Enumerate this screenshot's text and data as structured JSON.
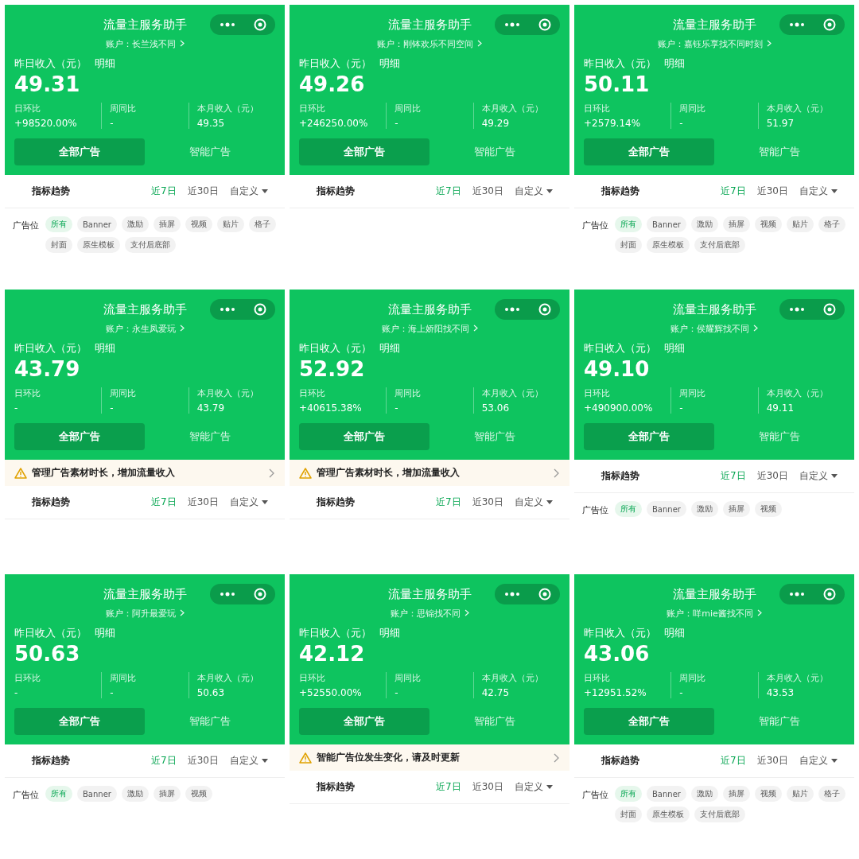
{
  "panels": [
    {
      "title": "流量主服务助手",
      "account": "账户：长兰浅不同",
      "income_label": "昨日收入（元）",
      "detail_link": "明细",
      "income": "49.31",
      "stats": [
        {
          "label": "日环比",
          "value": "+98520.00%"
        },
        {
          "label": "周同比",
          "value": "-"
        },
        {
          "label": "本月收入（元）",
          "value": "49.35"
        }
      ],
      "tabs": [
        {
          "label": "全部广告",
          "selected": true
        },
        {
          "label": "智能广告",
          "selected": false
        }
      ],
      "trend_title": "指标趋势",
      "ranges": [
        {
          "label": "近7日",
          "selected": true
        },
        {
          "label": "近30日",
          "selected": false
        },
        {
          "label": "自定义",
          "selected": false
        }
      ],
      "slot_label": "广告位",
      "slots": [
        {
          "label": "所有",
          "selected": true
        },
        {
          "label": "Banner",
          "selected": false
        },
        {
          "label": "激励",
          "selected": false
        },
        {
          "label": "插屏",
          "selected": false
        },
        {
          "label": "视频",
          "selected": false
        },
        {
          "label": "贴片",
          "selected": false
        },
        {
          "label": "格子",
          "selected": false
        },
        {
          "label": "封面",
          "selected": false
        },
        {
          "label": "原生模板",
          "selected": false
        },
        {
          "label": "支付后底部",
          "selected": false
        }
      ]
    },
    {
      "title": "流量主服务助手",
      "account": "账户：刚钵欢乐不同空间",
      "income_label": "昨日收入（元）",
      "detail_link": "明细",
      "income": "49.26",
      "stats": [
        {
          "label": "日环比",
          "value": "+246250.00%"
        },
        {
          "label": "周同比",
          "value": "-"
        },
        {
          "label": "本月收入（元）",
          "value": "49.29"
        }
      ],
      "tabs": [
        {
          "label": "全部广告",
          "selected": true
        },
        {
          "label": "智能广告",
          "selected": false
        }
      ],
      "trend_title": "指标趋势",
      "ranges": [
        {
          "label": "近7日",
          "selected": true
        },
        {
          "label": "近30日",
          "selected": false
        },
        {
          "label": "自定义",
          "selected": false
        }
      ]
    },
    {
      "title": "流量主服务助手",
      "account": "账户：嘉钰乐享找不同时刻",
      "income_label": "昨日收入（元）",
      "detail_link": "明细",
      "income": "50.11",
      "stats": [
        {
          "label": "日环比",
          "value": "+2579.14%"
        },
        {
          "label": "周同比",
          "value": "-"
        },
        {
          "label": "本月收入（元）",
          "value": "51.97"
        }
      ],
      "tabs": [
        {
          "label": "全部广告",
          "selected": true
        },
        {
          "label": "智能广告",
          "selected": false
        }
      ],
      "trend_title": "指标趋势",
      "ranges": [
        {
          "label": "近7日",
          "selected": true
        },
        {
          "label": "近30日",
          "selected": false
        },
        {
          "label": "自定义",
          "selected": false
        }
      ],
      "slot_label": "广告位",
      "slots": [
        {
          "label": "所有",
          "selected": true
        },
        {
          "label": "Banner",
          "selected": false
        },
        {
          "label": "激励",
          "selected": false
        },
        {
          "label": "插屏",
          "selected": false
        },
        {
          "label": "视频",
          "selected": false
        },
        {
          "label": "贴片",
          "selected": false
        },
        {
          "label": "格子",
          "selected": false
        },
        {
          "label": "封面",
          "selected": false
        },
        {
          "label": "原生模板",
          "selected": false
        },
        {
          "label": "支付后底部",
          "selected": false
        }
      ]
    },
    {
      "title": "流量主服务助手",
      "account": "账户：永生凤爱玩",
      "income_label": "昨日收入（元）",
      "detail_link": "明细",
      "income": "43.79",
      "stats": [
        {
          "label": "日环比",
          "value": "-"
        },
        {
          "label": "周同比",
          "value": "-"
        },
        {
          "label": "本月收入（元）",
          "value": "43.79"
        }
      ],
      "tabs": [
        {
          "label": "全部广告",
          "selected": true
        },
        {
          "label": "智能广告",
          "selected": false
        }
      ],
      "notice": "管理广告素材时长，增加流量收入",
      "trend_title": "指标趋势",
      "ranges": [
        {
          "label": "近7日",
          "selected": true
        },
        {
          "label": "近30日",
          "selected": false
        },
        {
          "label": "自定义",
          "selected": false
        }
      ]
    },
    {
      "title": "流量主服务助手",
      "account": "账户：海上娇阳找不同",
      "income_label": "昨日收入（元）",
      "detail_link": "明细",
      "income": "52.92",
      "stats": [
        {
          "label": "日环比",
          "value": "+40615.38%"
        },
        {
          "label": "周同比",
          "value": "-"
        },
        {
          "label": "本月收入（元）",
          "value": "53.06"
        }
      ],
      "tabs": [
        {
          "label": "全部广告",
          "selected": true
        },
        {
          "label": "智能广告",
          "selected": false
        }
      ],
      "notice": "管理广告素材时长，增加流量收入",
      "trend_title": "指标趋势",
      "ranges": [
        {
          "label": "近7日",
          "selected": true
        },
        {
          "label": "近30日",
          "selected": false
        },
        {
          "label": "自定义",
          "selected": false
        }
      ]
    },
    {
      "title": "流量主服务助手",
      "account": "账户：侯耀辉找不同",
      "income_label": "昨日收入（元）",
      "detail_link": "明细",
      "income": "49.10",
      "stats": [
        {
          "label": "日环比",
          "value": "+490900.00%"
        },
        {
          "label": "周同比",
          "value": "-"
        },
        {
          "label": "本月收入（元）",
          "value": "49.11"
        }
      ],
      "tabs": [
        {
          "label": "全部广告",
          "selected": true
        },
        {
          "label": "智能广告",
          "selected": false
        }
      ],
      "trend_title": "指标趋势",
      "ranges": [
        {
          "label": "近7日",
          "selected": true
        },
        {
          "label": "近30日",
          "selected": false
        },
        {
          "label": "自定义",
          "selected": false
        }
      ],
      "slot_label": "广告位",
      "slots": [
        {
          "label": "所有",
          "selected": true
        },
        {
          "label": "Banner",
          "selected": false
        },
        {
          "label": "激励",
          "selected": false
        },
        {
          "label": "插屏",
          "selected": false
        },
        {
          "label": "视频",
          "selected": false
        }
      ]
    },
    {
      "title": "流量主服务助手",
      "account": "账户：阿升最爱玩",
      "income_label": "昨日收入（元）",
      "detail_link": "明细",
      "income": "50.63",
      "stats": [
        {
          "label": "日环比",
          "value": "-"
        },
        {
          "label": "周同比",
          "value": "-"
        },
        {
          "label": "本月收入（元）",
          "value": "50.63"
        }
      ],
      "tabs": [
        {
          "label": "全部广告",
          "selected": true
        },
        {
          "label": "智能广告",
          "selected": false
        }
      ],
      "trend_title": "指标趋势",
      "ranges": [
        {
          "label": "近7日",
          "selected": true
        },
        {
          "label": "近30日",
          "selected": false
        },
        {
          "label": "自定义",
          "selected": false
        }
      ],
      "slot_label": "广告位",
      "slots": [
        {
          "label": "所有",
          "selected": true
        },
        {
          "label": "Banner",
          "selected": false
        },
        {
          "label": "激励",
          "selected": false
        },
        {
          "label": "插屏",
          "selected": false
        },
        {
          "label": "视频",
          "selected": false
        }
      ]
    },
    {
      "title": "流量主服务助手",
      "account": "账户：思锦找不同",
      "income_label": "昨日收入（元）",
      "detail_link": "明细",
      "income": "42.12",
      "stats": [
        {
          "label": "日环比",
          "value": "+52550.00%"
        },
        {
          "label": "周同比",
          "value": "-"
        },
        {
          "label": "本月收入（元）",
          "value": "42.75"
        }
      ],
      "tabs": [
        {
          "label": "全部广告",
          "selected": true
        },
        {
          "label": "智能广告",
          "selected": false
        }
      ],
      "notice": "智能广告位发生变化，请及时更新",
      "trend_title": "指标趋势",
      "ranges": [
        {
          "label": "近7日",
          "selected": true
        },
        {
          "label": "近30日",
          "selected": false
        },
        {
          "label": "自定义",
          "selected": false
        }
      ]
    },
    {
      "title": "流量主服务助手",
      "account": "账户：咩mie酱找不同",
      "income_label": "昨日收入（元）",
      "detail_link": "明细",
      "income": "43.06",
      "stats": [
        {
          "label": "日环比",
          "value": "+12951.52%"
        },
        {
          "label": "周同比",
          "value": "-"
        },
        {
          "label": "本月收入（元）",
          "value": "43.53"
        }
      ],
      "tabs": [
        {
          "label": "全部广告",
          "selected": true
        },
        {
          "label": "智能广告",
          "selected": false
        }
      ],
      "trend_title": "指标趋势",
      "ranges": [
        {
          "label": "近7日",
          "selected": true
        },
        {
          "label": "近30日",
          "selected": false
        },
        {
          "label": "自定义",
          "selected": false
        }
      ],
      "slot_label": "广告位",
      "slots": [
        {
          "label": "所有",
          "selected": true
        },
        {
          "label": "Banner",
          "selected": false
        },
        {
          "label": "激励",
          "selected": false
        },
        {
          "label": "插屏",
          "selected": false
        },
        {
          "label": "视频",
          "selected": false
        },
        {
          "label": "贴片",
          "selected": false
        },
        {
          "label": "格子",
          "selected": false
        },
        {
          "label": "封面",
          "selected": false
        },
        {
          "label": "原生模板",
          "selected": false
        },
        {
          "label": "支付后底部",
          "selected": false
        }
      ]
    }
  ]
}
